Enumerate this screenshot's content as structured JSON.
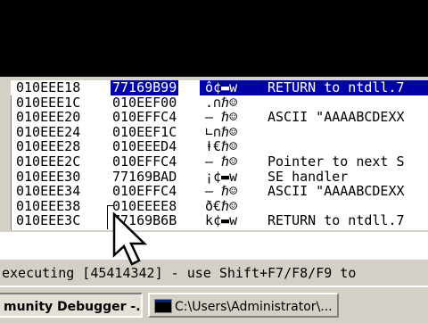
{
  "stack": {
    "rows": [
      {
        "addr": "010EEE18",
        "value": "77169B99",
        "chars": "ô¢▬w",
        "comment": "RETURN to ntdll.7",
        "selected": true
      },
      {
        "addr": "010EEE1C",
        "value": "010EEF00",
        "chars": ".∩ℏ☺",
        "comment": "",
        "selected": false
      },
      {
        "addr": "010EEE20",
        "value": "010EFFC4",
        "chars": "— ℏ☺",
        "comment": "ASCII \"AAAABCDEXX",
        "selected": false
      },
      {
        "addr": "010EEE24",
        "value": "010EEF1C",
        "chars": "∟∩ℏ☺",
        "comment": "",
        "selected": false
      },
      {
        "addr": "010EEE28",
        "value": "010EEED4",
        "chars": "ⱡ€ℏ☺",
        "comment": "",
        "selected": false
      },
      {
        "addr": "010EEE2C",
        "value": "010EFFC4",
        "chars": "— ℏ☺",
        "comment": "Pointer to next S",
        "selected": false
      },
      {
        "addr": "010EEE30",
        "value": "77169BAD",
        "chars": "¡¢▬w",
        "comment": "SE handler",
        "selected": false
      },
      {
        "addr": "010EEE34",
        "value": "010EFFC4",
        "chars": "— ℏ☺",
        "comment": "ASCII \"AAAABCDEXX",
        "selected": false
      },
      {
        "addr": "010EEE38",
        "value": "010EEEE8",
        "chars": "ð€ℏ☺",
        "comment": "",
        "selected": false
      },
      {
        "addr": "010EEE3C",
        "value": "77169B6B",
        "chars": "k¢▬w",
        "comment": "RETURN to ntdll.7",
        "selected": false
      }
    ]
  },
  "status_bar": {
    "text": "executing [45414342] - use Shift+F7/F8/F9 to"
  },
  "taskbar": {
    "debugger_label": "munity Debugger -...",
    "cmd_label": "C:\\Users\\Administrator\\..."
  },
  "icons": {
    "cursor": "mouse-pointer-icon",
    "cmd": "cmd-icon"
  }
}
